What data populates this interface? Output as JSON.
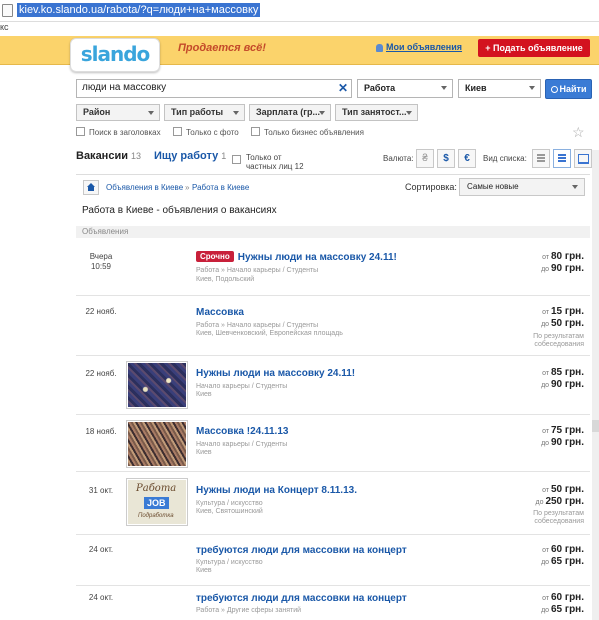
{
  "browser": {
    "url": "kiev.ko.slando.ua/rabota/?q=люди+на+массовку",
    "tab_label": "кс"
  },
  "header": {
    "logo": "slando",
    "slogan": "Продается всё!",
    "my_ads": "Мои объявления",
    "post_ad": "+ Подать объявление"
  },
  "search": {
    "query": "люди на массовку",
    "category": "Работа",
    "city": "Киев",
    "find_label": "Найти"
  },
  "filters": [
    "Район",
    "Тип работы",
    "Зарплата (гр...",
    "Тип занятост..."
  ],
  "checkboxes": {
    "titles_only": "Поиск в заголовках",
    "photo_only": "Только с фото",
    "business_only": "Только бизнес объявления"
  },
  "tabs": {
    "vacancies": "Вакансии",
    "vacancies_count": "13",
    "seeking": "Ищу работу",
    "seeking_count": "1",
    "private_label": "Только от частных лиц 12"
  },
  "currency": {
    "label": "Валюта:",
    "options": [
      "₴",
      "$",
      "€"
    ]
  },
  "view": {
    "label": "Вид списка:"
  },
  "breadcrumb": [
    "Объявления в Киеве",
    "Работа в Киеве"
  ],
  "sort": {
    "label": "Сортировка:",
    "value": "Самые новые"
  },
  "page_title": "Работа в Киеве - объявления о вакансиях",
  "section_label": "Объявления",
  "listings": [
    {
      "date": "Вчера",
      "time": "10:59",
      "urgent": "Срочно",
      "title": "Нужны люди на массовку 24.11!",
      "meta1": "Работа » Начало карьеры / Студенты",
      "meta2": "Киев, Подольский",
      "from_label": "от",
      "from": "80 грн.",
      "to_label": "до",
      "to": "90 грн.",
      "note": ""
    },
    {
      "date": "22 нояб.",
      "title": "Массовка",
      "meta1": "Работа » Начало карьеры / Студенты",
      "meta2": "Киев, Шевченковский, Европейская площадь",
      "from_label": "от",
      "from": "15 грн.",
      "to_label": "до",
      "to": "50 грн.",
      "note": "По результатам собеседования"
    },
    {
      "date": "22 нояб.",
      "title": "Нужны люди на массовку 24.11!",
      "meta1": "Начало карьеры / Студенты",
      "meta2": "Киев",
      "from_label": "от",
      "from": "85 грн.",
      "to_label": "до",
      "to": "90 грн.",
      "note": ""
    },
    {
      "date": "18 нояб.",
      "title": "Массовка !24.11.13",
      "meta1": "Начало карьеры / Студенты",
      "meta2": "Киев",
      "from_label": "от",
      "from": "75 грн.",
      "to_label": "до",
      "to": "90 грн.",
      "note": ""
    },
    {
      "date": "31 окт.",
      "title": "Нужны люди на Концерт 8.11.13.",
      "meta1": "Культура / искусство",
      "meta2": "Киев, Святошинский",
      "from_label": "от",
      "from": "50 грн.",
      "to_label": "до",
      "to": "250 грн.",
      "note": "По результатам собеседования",
      "thumb_text1": "Работа",
      "thumb_text2": "JOB",
      "thumb_text3": "Подработка"
    },
    {
      "date": "24 окт.",
      "title": "требуются люди для массовки на концерт",
      "meta1": "Культура / искусство",
      "meta2": "Киев",
      "from_label": "от",
      "from": "60 грн.",
      "to_label": "до",
      "to": "65 грн.",
      "note": ""
    },
    {
      "date": "24 окт.",
      "title": "требуются люди для массовки на концерт",
      "meta1": "Работа » Другие сферы занятий",
      "meta2": "",
      "from_label": "от",
      "from": "60 грн.",
      "to_label": "до",
      "to": "65 грн.",
      "note": ""
    }
  ],
  "colors": {
    "header_bg": "#fbd36b",
    "link": "#1a58a8",
    "post_button": "#d3121f",
    "urgent": "#c8203a",
    "find_button": "#3a7bd5"
  }
}
